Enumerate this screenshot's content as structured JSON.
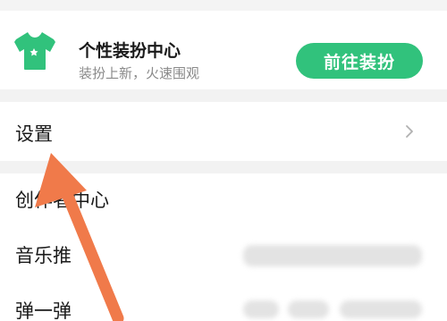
{
  "promo": {
    "title": "个性装扮中心",
    "subtitle": "装扮上新，火速围观",
    "button_label": "前往装扮",
    "icon": "tshirt-icon",
    "accent_color": "#31c27c"
  },
  "settings": {
    "label": "设置",
    "chevron": "chevron-right-icon"
  },
  "menu": {
    "items": [
      {
        "label": "创作者中心"
      },
      {
        "label": "音乐推"
      },
      {
        "label": "弹一弹"
      }
    ]
  },
  "annotation": {
    "arrow_color": "#f07a4a",
    "target": "设置"
  }
}
